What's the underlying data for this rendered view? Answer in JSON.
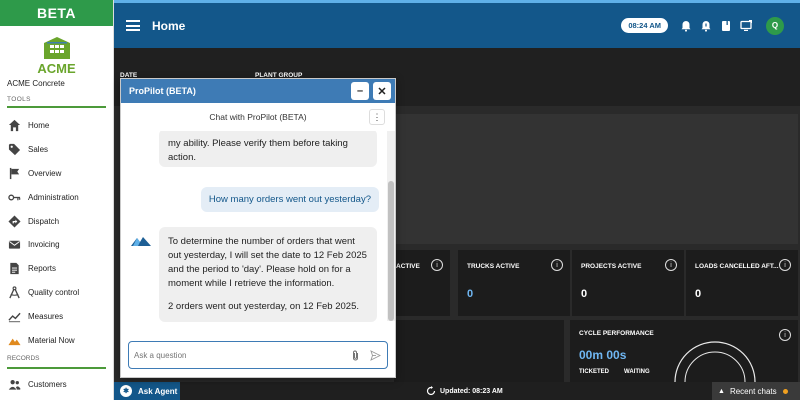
{
  "sidebar": {
    "beta_label": "BETA",
    "logo_text": "ACME",
    "company": "ACME Concrete",
    "tools_label": "TOOLS",
    "records_label": "RECORDS",
    "items": [
      {
        "label": "Home",
        "icon": "home-icon"
      },
      {
        "label": "Sales",
        "icon": "tag-icon"
      },
      {
        "label": "Overview",
        "icon": "flag-icon"
      },
      {
        "label": "Administration",
        "icon": "key-icon"
      },
      {
        "label": "Dispatch",
        "icon": "directions-icon"
      },
      {
        "label": "Invoicing",
        "icon": "mail-icon"
      },
      {
        "label": "Reports",
        "icon": "document-icon"
      },
      {
        "label": "Quality control",
        "icon": "compass-icon"
      },
      {
        "label": "Measures",
        "icon": "chart-line-icon"
      },
      {
        "label": "Material Now",
        "icon": "mountain-icon"
      }
    ],
    "records_items": [
      {
        "label": "Customers",
        "icon": "people-icon"
      }
    ]
  },
  "header": {
    "title": "Home",
    "time": "08:24 AM",
    "avatar_initial": "Q"
  },
  "filters": {
    "date_label": "DATE",
    "plant_group_label": "PLANT GROUP"
  },
  "kpis": [
    {
      "title": "ACTIVE",
      "value": ""
    },
    {
      "title": "TRUCKS ACTIVE",
      "value": "0"
    },
    {
      "title": "PROJECTS ACTIVE",
      "value": "0"
    },
    {
      "title": "LOADS CANCELLED AFT...",
      "value": "0"
    }
  ],
  "cycle": {
    "title": "CYCLE PERFORMANCE",
    "value": "00m 00s",
    "ticketed": "TICKETED",
    "waiting": "WAITING"
  },
  "footer": {
    "ask_agent": "Ask Agent",
    "updated": "Updated: 08:23 AM",
    "recent_chats": "Recent chats"
  },
  "chat": {
    "title": "ProPilot (BETA)",
    "subtitle": "Chat with ProPilot (BETA)",
    "messages": {
      "bot_1": "my ability. Please verify them before taking action.",
      "user_1": "How many orders went out yesterday?",
      "bot_2_p1": "To determine the number of orders that went out yesterday, I will set the date to 12 Feb 2025 and the period to 'day'. Please hold on for a moment while I retrieve the information.",
      "bot_2_p2": "2 orders went out yesterday, on 12 Feb 2025."
    },
    "input_placeholder": "Ask a question"
  },
  "colors": {
    "brand_green": "#2e9a4a",
    "header_blue": "#13578a",
    "chat_blue": "#3e7bb5",
    "kpi_blue": "#6fb6f2"
  }
}
